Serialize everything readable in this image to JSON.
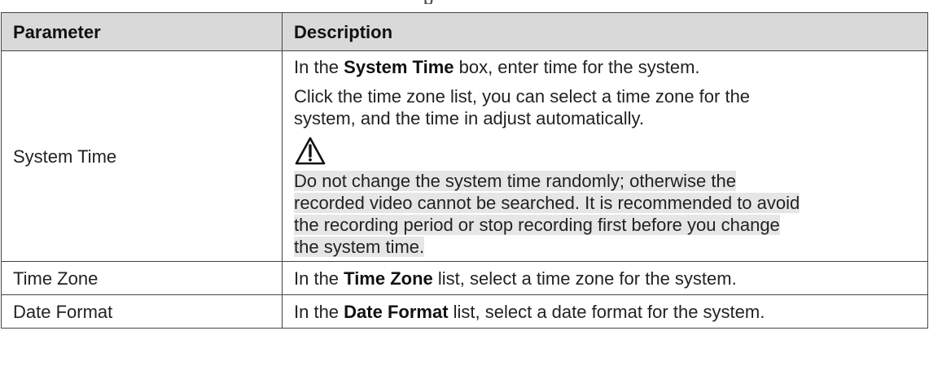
{
  "caption_fragment": "p",
  "table": {
    "headers": {
      "parameter": "Parameter",
      "description": "Description"
    },
    "rows": {
      "system_time": {
        "parameter": "System Time",
        "line1": {
          "before": "In the ",
          "bold": "System Time",
          "after": " box, enter time for the system."
        },
        "line2a": "Click the time zone list, you can select a time zone for the",
        "line2b": "system, and the time in adjust automatically.",
        "caution_icon": "caution-triangle-icon",
        "warning_lines": [
          "Do not change the system time randomly; otherwise the",
          "recorded video cannot be searched. It is recommended to avoid",
          "the recording period or stop recording first before you change",
          "the system time."
        ]
      },
      "time_zone": {
        "parameter": "Time Zone",
        "before": "In the ",
        "bold": "Time Zone",
        "after": " list, select a time zone for the system."
      },
      "date_format": {
        "parameter": "Date Format",
        "before": "In the ",
        "bold": "Date Format",
        "after": " list, select a date format for the system."
      }
    }
  },
  "colors": {
    "header_bg": "#d9d9d9",
    "highlight_bg": "#e6e6e6",
    "border": "#444444"
  }
}
